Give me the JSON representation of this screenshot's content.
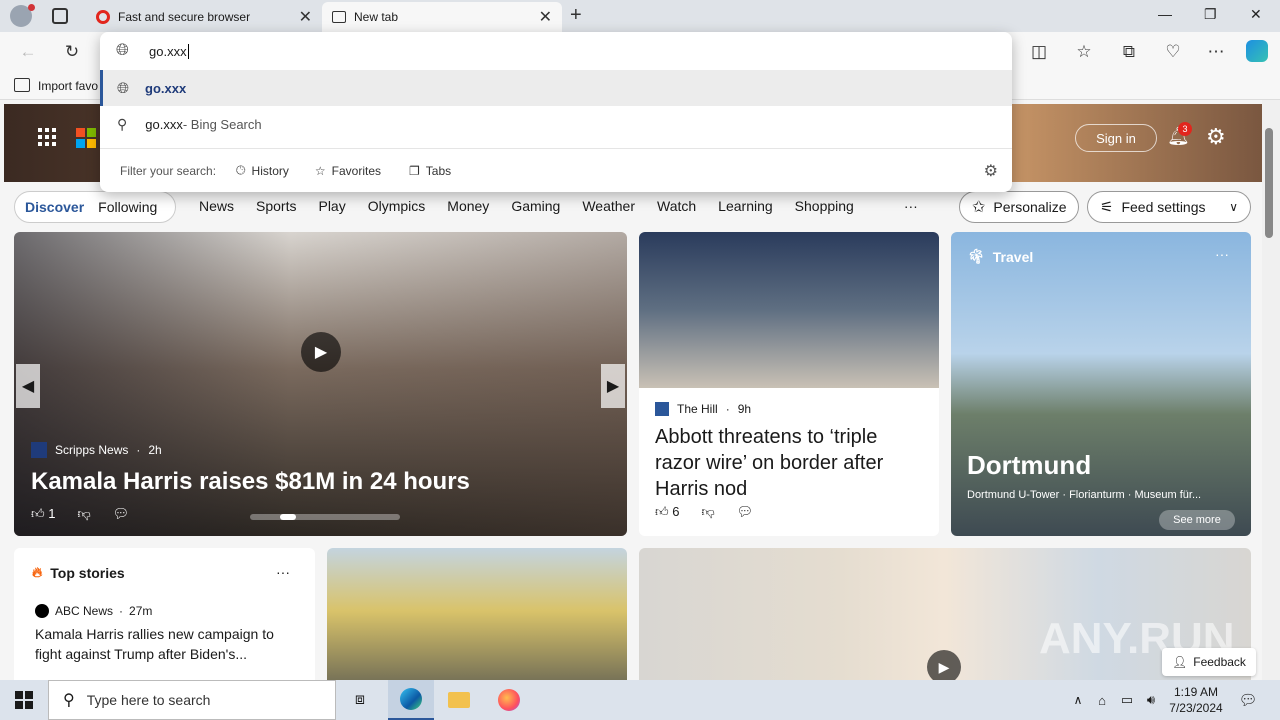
{
  "tabs": [
    {
      "title": "Fast and secure browser"
    },
    {
      "title": "New tab"
    }
  ],
  "address": {
    "value": "go.xxx"
  },
  "favorites_bar": {
    "import_label": "Import favo"
  },
  "suggestions": [
    {
      "text": "go.xxx",
      "type": "url"
    },
    {
      "text": "go.xxx",
      "suffix": " - Bing Search",
      "type": "search"
    }
  ],
  "filter": {
    "label": "Filter your search:",
    "options": [
      "History",
      "Favorites",
      "Tabs"
    ]
  },
  "header": {
    "sign_in": "Sign in",
    "notifications_count": "3"
  },
  "nav": {
    "discover": "Discover",
    "following": "Following",
    "items": [
      "News",
      "Sports",
      "Play",
      "Olympics",
      "Money",
      "Gaming",
      "Weather",
      "Watch",
      "Learning",
      "Shopping"
    ],
    "more": "···",
    "personalize": "Personalize",
    "feed_settings": "Feed settings"
  },
  "main_story": {
    "source": "Scripps News",
    "age": "2h",
    "title": "Kamala Harris raises $81M in 24 hours",
    "likes": "1"
  },
  "story2": {
    "source": "The Hill",
    "age": "9h",
    "title": "Abbott threatens to ‘triple razor wire’ on border after Harris nod",
    "likes": "6"
  },
  "travel": {
    "label": "Travel",
    "title": "Dortmund",
    "caption": "Dortmund U-Tower · Florianturm · Museum für...",
    "see_more": "See more"
  },
  "top_stories": {
    "title": "Top stories",
    "source": "ABC News",
    "age": "27m",
    "headline": "Kamala Harris rallies new campaign to fight against Trump after Biden's..."
  },
  "feedback": "Feedback",
  "watermark": "ANY.RUN",
  "taskbar": {
    "search_placeholder": "Type here to search",
    "time": "1:19 AM",
    "date": "7/23/2024"
  },
  "colors": {
    "accent": "#2b579a",
    "brand_red": "#e2261d"
  }
}
